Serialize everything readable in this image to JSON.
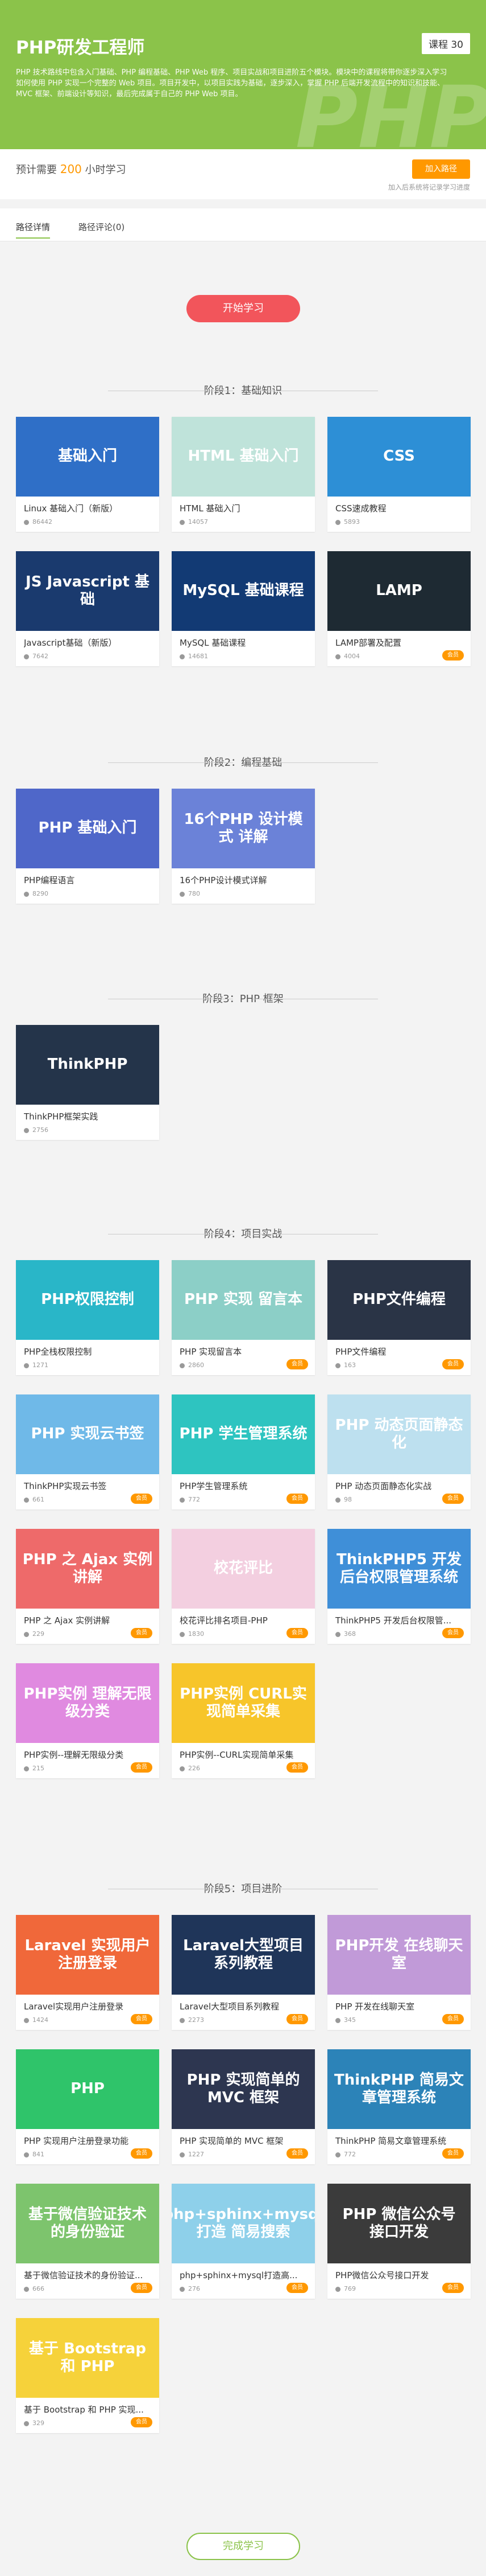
{
  "header": {
    "title": "PHP研发工程师",
    "badge": "课程 30",
    "bg_text": "PHP",
    "description": "PHP 技术路线中包含入门基础、PHP 编程基础、PHP Web 程序、项目实战和项目进阶五个模块。模块中的课程将带你逐步深入学习如何使用 PHP 实现一个完整的 Web 项目。项目开发中，以项目实践为基础，逐步深入，掌握 PHP 后端开发流程中的知识和技能、MVC 框架、前端设计等知识，最后完成属于自己的 PHP Web 项目。"
  },
  "info": {
    "study_prefix": "预计需要",
    "study_hours": "200",
    "study_suffix": "小时学习",
    "join_button": "加入路径",
    "note": "加入后系统将记录学习进度"
  },
  "tabs": [
    "路径详情",
    "路径评论(0)"
  ],
  "start_button": "开始学习",
  "finish_button": "完成学习",
  "colors": {
    "accent": "#8bc34a",
    "orange": "#ff9800",
    "red": "#f2555b"
  },
  "stages": [
    {
      "label": "阶段1：基础知识",
      "courses": [
        {
          "title": "Linux 基础入门（新版）",
          "count": "86442",
          "tag": "",
          "thumb": "基础入门",
          "bg": "#2f6fc7"
        },
        {
          "title": "HTML 基础入门",
          "count": "14057",
          "tag": "",
          "thumb": "HTML 基础入门",
          "bg": "#bfe3da"
        },
        {
          "title": "CSS速成教程",
          "count": "5893",
          "tag": "",
          "thumb": "CSS",
          "bg": "#2d8fd6"
        },
        {
          "title": "Javascript基础（新版）",
          "count": "7642",
          "tag": "",
          "thumb": "JS Javascript 基础",
          "bg": "#1a3a6e"
        },
        {
          "title": "MySQL 基础课程",
          "count": "14681",
          "tag": "",
          "thumb": "MySQL 基础课程",
          "bg": "#123a74"
        },
        {
          "title": "LAMP部署及配置",
          "count": "4004",
          "tag": "会员",
          "thumb": "LAMP",
          "bg": "#1e2a33"
        }
      ]
    },
    {
      "label": "阶段2：编程基础",
      "courses": [
        {
          "title": "PHP编程语言",
          "count": "8290",
          "tag": "",
          "thumb": "PHP 基础入门",
          "bg": "#4f67c9"
        },
        {
          "title": "16个PHP设计模式详解",
          "count": "780",
          "tag": "",
          "thumb": "16个PHP 设计模式 详解",
          "bg": "#6b82d8"
        }
      ]
    },
    {
      "label": "阶段3：PHP 框架",
      "courses": [
        {
          "title": "ThinkPHP框架实践",
          "count": "2756",
          "tag": "",
          "thumb": "ThinkPHP",
          "bg": "#24344a"
        }
      ]
    },
    {
      "label": "阶段4：项目实战",
      "courses": [
        {
          "title": "PHP全栈权限控制",
          "count": "1271",
          "tag": "",
          "thumb": "PHP权限控制",
          "bg": "#29b6c8"
        },
        {
          "title": "PHP 实现留言本",
          "count": "2860",
          "tag": "会员",
          "thumb": "PHP 实现 留言本",
          "bg": "#8ccfc7"
        },
        {
          "title": "PHP文件编程",
          "count": "163",
          "tag": "会员",
          "thumb": "PHP文件编程",
          "bg": "#2a3446"
        },
        {
          "title": "ThinkPHP实现云书签",
          "count": "661",
          "tag": "会员",
          "thumb": "PHP 实现云书签",
          "bg": "#6fb9e8"
        },
        {
          "title": "PHP学生管理系统",
          "count": "772",
          "tag": "会员",
          "thumb": "PHP 学生管理系统",
          "bg": "#2ec4c0"
        },
        {
          "title": "PHP 动态页面静态化实战",
          "count": "98",
          "tag": "会员",
          "thumb": "PHP 动态页面静态化",
          "bg": "#bde0ef"
        },
        {
          "title": "PHP 之 Ajax 实例讲解",
          "count": "229",
          "tag": "会员",
          "thumb": "PHP 之 Ajax 实例讲解",
          "bg": "#ee6a6a"
        },
        {
          "title": "校花评比排名项目-PHP",
          "count": "1830",
          "tag": "会员",
          "thumb": "校花评比",
          "bg": "#f3cfe0"
        },
        {
          "title": "ThinkPHP5 开发后台权限管...",
          "count": "368",
          "tag": "会员",
          "thumb": "ThinkPHP5 开发后台权限管理系统",
          "bg": "#3f8fd8"
        },
        {
          "title": "PHP实例--理解无限级分类",
          "count": "215",
          "tag": "会员",
          "thumb": "PHP实例 理解无限级分类",
          "bg": "#e08ae0"
        },
        {
          "title": "PHP实例--CURL实现简单采集",
          "count": "226",
          "tag": "会员",
          "thumb": "PHP实例 CURL实现简单采集",
          "bg": "#f7c52a"
        }
      ]
    },
    {
      "label": "阶段5：项目进阶",
      "courses": [
        {
          "title": "Laravel实现用户注册登录",
          "count": "1424",
          "tag": "会员",
          "thumb": "Laravel 实现用户注册登录",
          "bg": "#f0683a"
        },
        {
          "title": "Laravel大型项目系列教程",
          "count": "2273",
          "tag": "会员",
          "thumb": "Laravel大型项目系列教程",
          "bg": "#1f3559"
        },
        {
          "title": "PHP 开发在线聊天室",
          "count": "345",
          "tag": "会员",
          "thumb": "PHP开发 在线聊天室",
          "bg": "#c19ad8"
        },
        {
          "title": "PHP 实现用户注册登录功能",
          "count": "841",
          "tag": "会员",
          "thumb": "PHP",
          "bg": "#2fc46a"
        },
        {
          "title": "PHP 实现简单的 MVC 框架",
          "count": "1227",
          "tag": "会员",
          "thumb": "PHP 实现简单的 MVC 框架",
          "bg": "#2d3650"
        },
        {
          "title": "ThinkPHP 简易文章管理系统",
          "count": "772",
          "tag": "会员",
          "thumb": "ThinkPHP 简易文章管理系统",
          "bg": "#2c83b8"
        },
        {
          "title": "基于微信验证技术的身份验证...",
          "count": "666",
          "tag": "会员",
          "thumb": "基于微信验证技术的身份验证",
          "bg": "#7dc46d"
        },
        {
          "title": "php+sphinx+mysql打造高...",
          "count": "276",
          "tag": "会员",
          "thumb": "php+sphinx+mysql 打造 简易搜索",
          "bg": "#8ed0ea"
        },
        {
          "title": "PHP微信公众号接口开发",
          "count": "769",
          "tag": "会员",
          "thumb": "PHP 微信公众号 接口开发",
          "bg": "#3b3b3b"
        },
        {
          "title": "基于 Bootstrap 和 PHP 实现...",
          "count": "329",
          "tag": "会员",
          "thumb": "基于 Bootstrap 和 PHP",
          "bg": "#f6d23a"
        }
      ]
    }
  ]
}
